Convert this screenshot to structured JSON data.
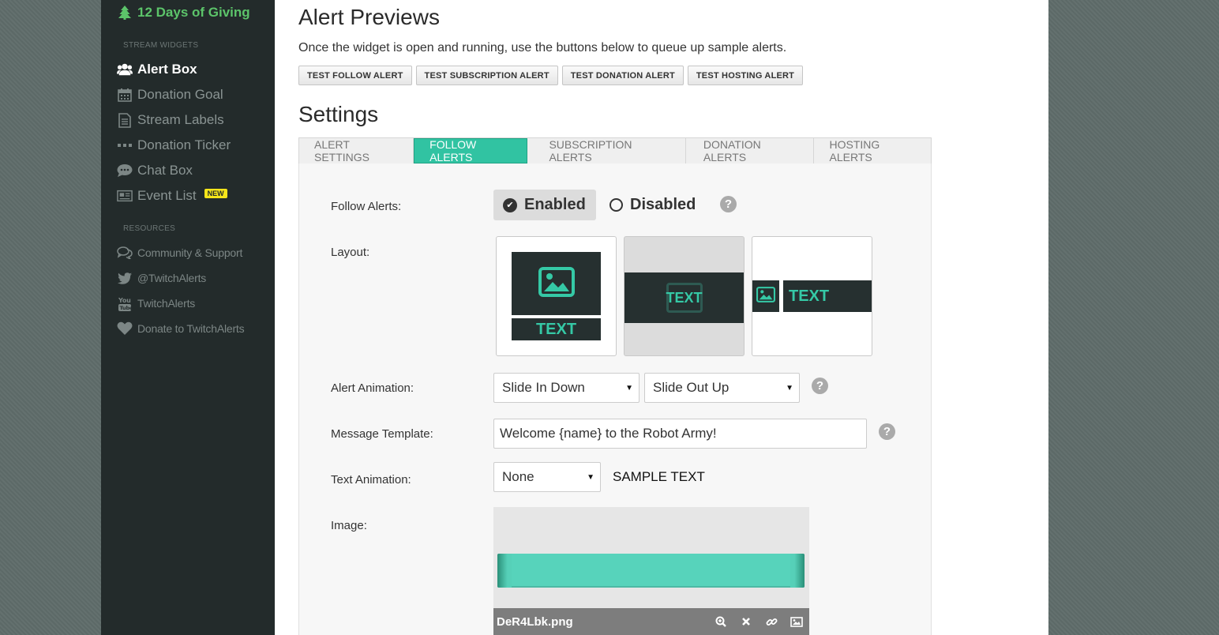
{
  "sidebar": {
    "promo": "12 Days of Giving",
    "section_widgets": "STREAM WIDGETS",
    "widgets": [
      {
        "label": "Alert Box",
        "icon": "users-icon"
      },
      {
        "label": "Donation Goal",
        "icon": "calendar-icon"
      },
      {
        "label": "Stream Labels",
        "icon": "document-icon"
      },
      {
        "label": "Donation Ticker",
        "icon": "ellipsis-icon"
      },
      {
        "label": "Chat Box",
        "icon": "chat-bubble-icon"
      },
      {
        "label": "Event List",
        "icon": "newspaper-icon",
        "badge": "NEW"
      }
    ],
    "section_resources": "RESOURCES",
    "resources": [
      {
        "label": "Community & Support",
        "icon": "comments-icon"
      },
      {
        "label": "@TwitchAlerts",
        "icon": "twitter-icon"
      },
      {
        "label": "TwitchAlerts",
        "icon": "youtube-icon"
      },
      {
        "label": "Donate to TwitchAlerts",
        "icon": "heart-icon"
      }
    ]
  },
  "previews": {
    "title": "Alert Previews",
    "description": "Once the widget is open and running, use the buttons below to queue up sample alerts.",
    "buttons": [
      "TEST FOLLOW ALERT",
      "TEST SUBSCRIPTION ALERT",
      "TEST DONATION ALERT",
      "TEST HOSTING ALERT"
    ]
  },
  "settings": {
    "title": "Settings",
    "tabs": [
      "ALERT SETTINGS",
      "FOLLOW ALERTS",
      "SUBSCRIPTION ALERTS",
      "DONATION ALERTS",
      "HOSTING ALERTS"
    ],
    "active_tab": "FOLLOW ALERTS",
    "follow_alerts_label": "Follow Alerts:",
    "enabled_label": "Enabled",
    "disabled_label": "Disabled",
    "layout_label": "Layout:",
    "layout_text": "TEXT",
    "layout_selected": 2,
    "alert_animation_label": "Alert Animation:",
    "animation_in": "Slide In Down",
    "animation_out": "Slide Out Up",
    "message_template_label": "Message Template:",
    "message_template_value": "Welcome {name} to the Robot Army!",
    "text_animation_label": "Text Animation:",
    "text_animation_value": "None",
    "sample_text": "SAMPLE TEXT",
    "image_label": "Image:",
    "image_filename": "DeR4Lbk.png"
  },
  "colors": {
    "accent": "#31c3a2",
    "sidebar_bg": "#232b2b",
    "promo_green": "#5cc46a",
    "badge_yellow": "#f6e51a"
  }
}
